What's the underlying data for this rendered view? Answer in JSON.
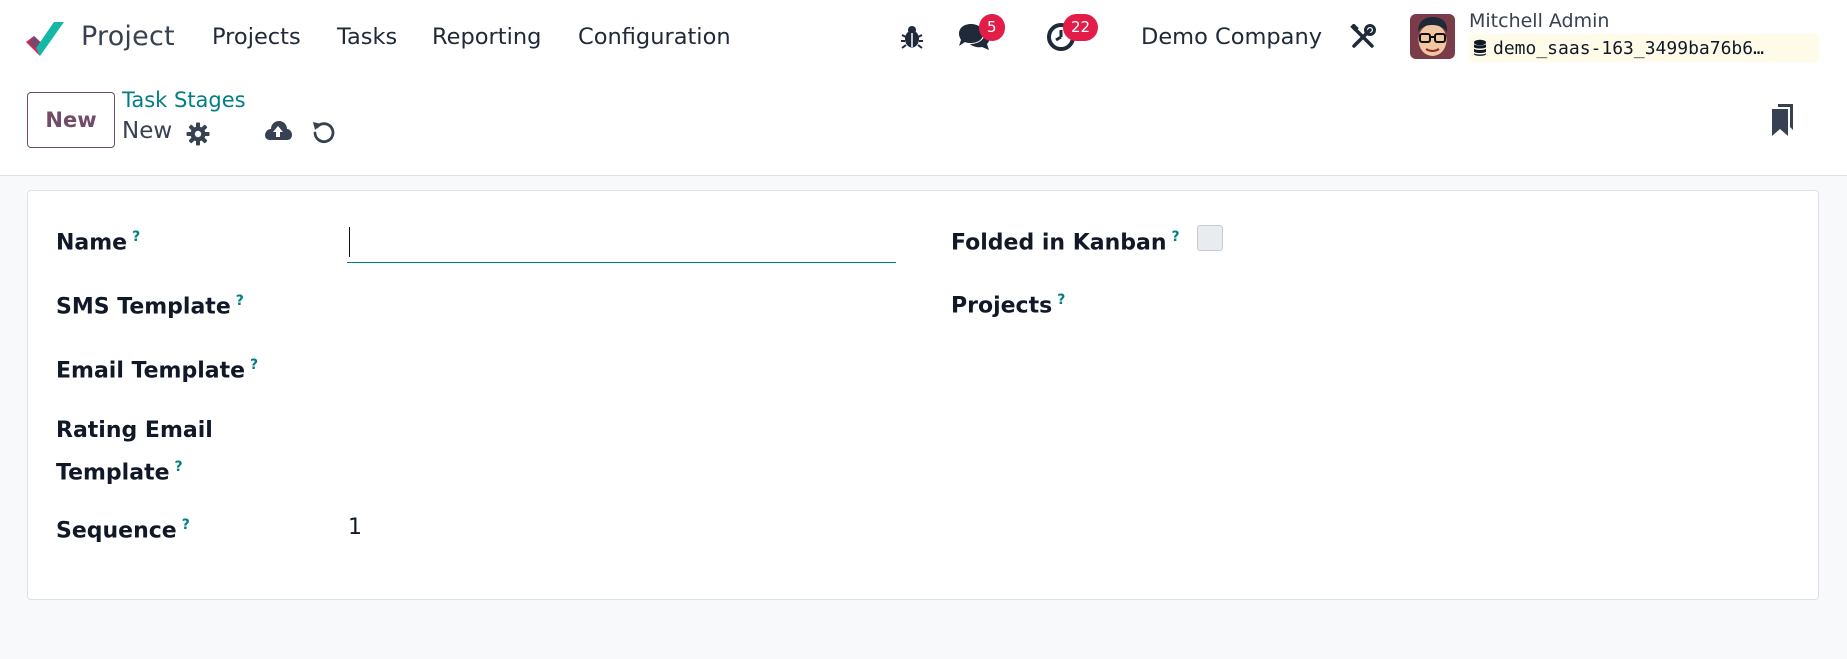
{
  "app": {
    "name": "Project",
    "brand_colors": [
      "#e41e59",
      "#14b8a6",
      "#714b67"
    ]
  },
  "menu": {
    "items": [
      "Projects",
      "Tasks",
      "Reporting",
      "Configuration"
    ]
  },
  "systray": {
    "debug_icon": "bug-icon",
    "messages_icon": "chat-bubbles-icon",
    "messages_count": "5",
    "activities_icon": "clock-icon",
    "activities_count": "22",
    "company": "Demo Company",
    "settings_icon": "tools-icon",
    "user_name": "Mitchell Admin",
    "database": "demo_saas-163_3499ba76b6…"
  },
  "control_panel": {
    "new_button": "New",
    "breadcrumb_parent": "Task Stages",
    "breadcrumb_current": "New",
    "gear_icon": "gear-icon",
    "save_icon": "cloud-upload-icon",
    "discard_icon": "undo-icon",
    "bookmark_icon": "bookmarks-icon"
  },
  "form": {
    "name": {
      "label": "Name",
      "help": "?",
      "value": ""
    },
    "sms_template": {
      "label": "SMS Template",
      "help": "?"
    },
    "email_template": {
      "label": "Email Template",
      "help": "?"
    },
    "rating_email_template": {
      "label_line1": "Rating Email",
      "label_line2": "Template",
      "help": "?"
    },
    "sequence": {
      "label": "Sequence",
      "help": "?",
      "value": "1"
    },
    "folded_in_kanban": {
      "label": "Folded in Kanban",
      "help": "?",
      "checked": false
    },
    "projects": {
      "label": "Projects",
      "help": "?"
    }
  },
  "colors": {
    "accent": "#017e84",
    "primary": "#714b67",
    "badge": "#e11d48",
    "background": "#f8f9fa"
  }
}
